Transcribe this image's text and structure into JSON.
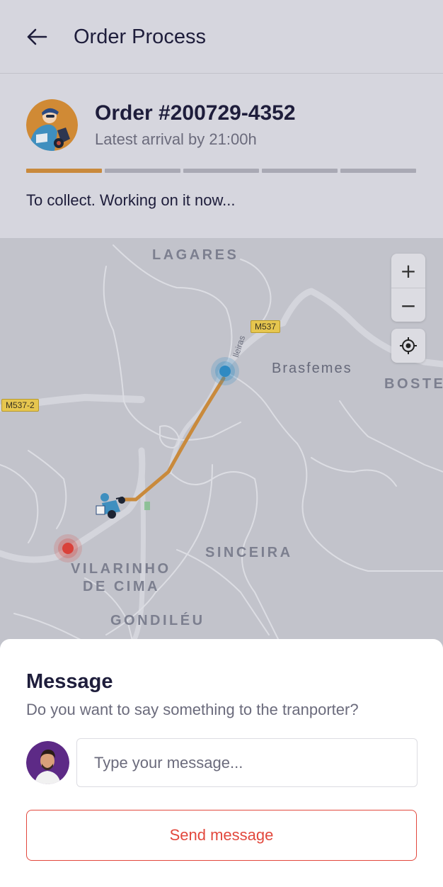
{
  "header": {
    "title": "Order Process"
  },
  "order": {
    "number": "Order #200729-4352",
    "arrival": "Latest arrival by 21:00h",
    "status": "To collect. Working on it now...",
    "progress_total_steps": 5,
    "progress_completed_steps": 1
  },
  "map": {
    "places": {
      "lagares": "LAGARES",
      "brasfemes": "Brasfemes",
      "boste": "BOSTE",
      "sinceira": "SINCEIRA",
      "vilarinho_1": "VILARINHO",
      "vilarinho_2": "DE CIMA",
      "gondileu": "GONDILÉU",
      "street": "lleiras"
    },
    "roads": {
      "m537": "M537",
      "m5372": "M537-2"
    },
    "controls": {
      "zoom_in": "+",
      "zoom_out": "−"
    },
    "colors": {
      "route": "#c98a3c",
      "origin": "#2f8ac2",
      "destination": "#d9413a"
    }
  },
  "message": {
    "title": "Message",
    "subtitle": "Do you want to say something to the tranporter?",
    "placeholder": "Type your message...",
    "send_label": "Send message"
  },
  "colors": {
    "accent": "#e2483d",
    "progress": "#c98a3c",
    "text": "#1e1d3b"
  },
  "icons": {
    "back": "arrow-left-icon",
    "locate": "locate-icon",
    "transporter": "scooter-rider-icon"
  }
}
